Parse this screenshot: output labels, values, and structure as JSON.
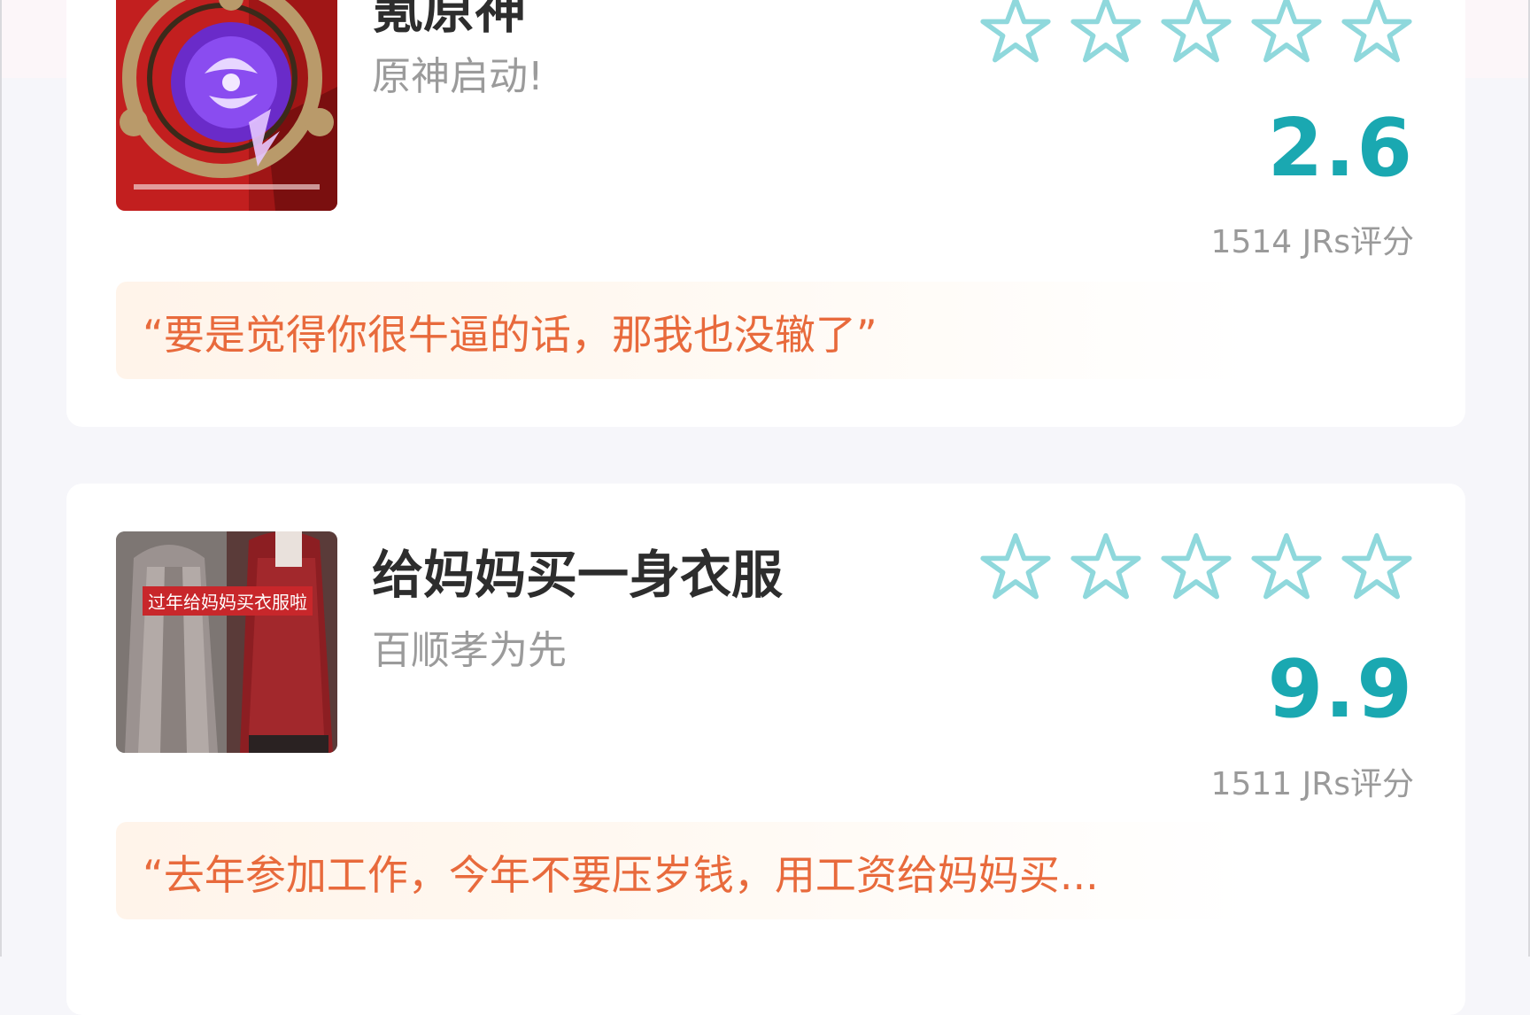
{
  "cards": [
    {
      "title": "氪原神",
      "subtitle": "原神启动!",
      "score": "2.6",
      "rating_count": "1514 JRs评分",
      "quote": "“要是觉得你很牛逼的话，那我也没辙了”",
      "stars_filled": 0,
      "stars_total": 5,
      "thumbnail_caption": "",
      "thumbnail_icon": "genshin-vision-emblem-icon"
    },
    {
      "title": "给妈妈买一身衣服",
      "subtitle": "百顺孝为先",
      "score": "9.9",
      "rating_count": "1511 JRs评分",
      "quote": "“去年参加工作，今年不要压岁钱，用工资给妈妈买...",
      "stars_filled": 0,
      "stars_total": 5,
      "thumbnail_caption": "过年给妈妈买衣服啦",
      "thumbnail_icon": "coat-photo"
    }
  ],
  "colors": {
    "accent": "#1aa8b1",
    "star_outline": "#8fd8dc",
    "quote_text": "#e86a3c",
    "quote_bg": "#fff4ea"
  }
}
